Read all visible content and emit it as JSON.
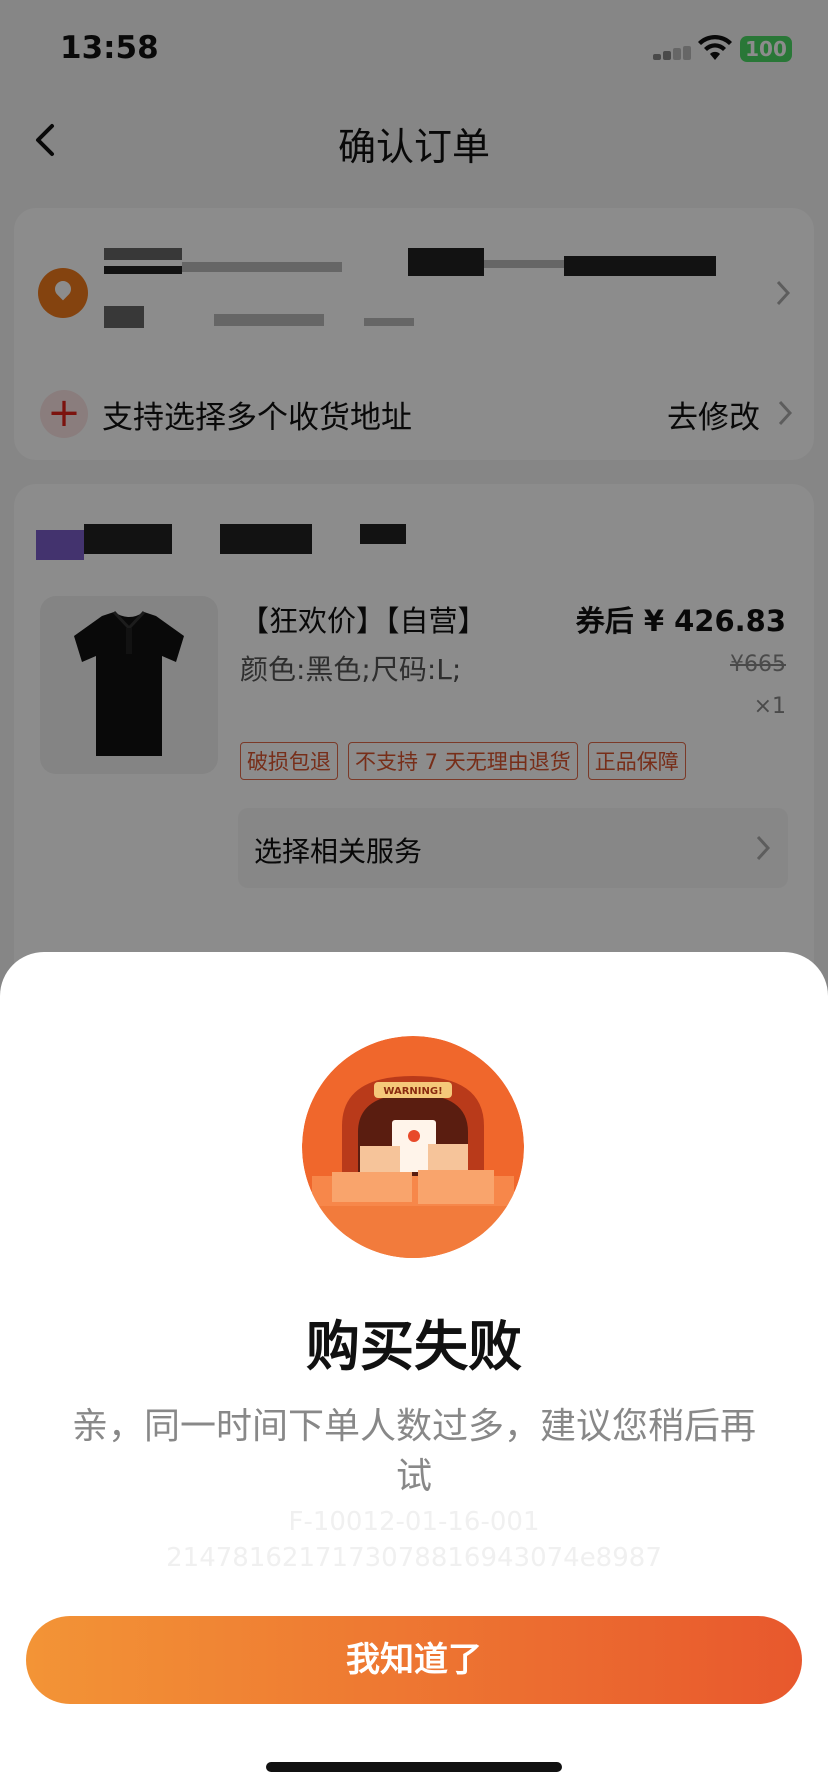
{
  "status_bar": {
    "time": "13:58",
    "battery": "100"
  },
  "nav": {
    "title": "确认订单"
  },
  "address": {
    "multi_address_label": "支持选择多个收货地址",
    "modify_label": "去修改"
  },
  "product": {
    "title": "【狂欢价】【自营】",
    "price": "券后 ¥ 426.83",
    "spec": "颜色:黑色;尺码:L;",
    "original_price": "¥665",
    "quantity": "×1",
    "tags": [
      "破损包退",
      "不支持 7 天无理由退货",
      "正品保障"
    ],
    "service_label": "选择相关服务"
  },
  "dialog": {
    "title": "购买失败",
    "message": "亲，同一时间下单人数过多，建议您稍后再试",
    "error_code_line1": "F-10012-01-16-001",
    "error_code_line2": "2147816217173078816943074e8987",
    "illustration_text": "WARNING!",
    "button_label": "我知道了"
  },
  "colors": {
    "accent_start": "#f39436",
    "accent_end": "#e8582d",
    "tag_color": "#d9542f"
  }
}
